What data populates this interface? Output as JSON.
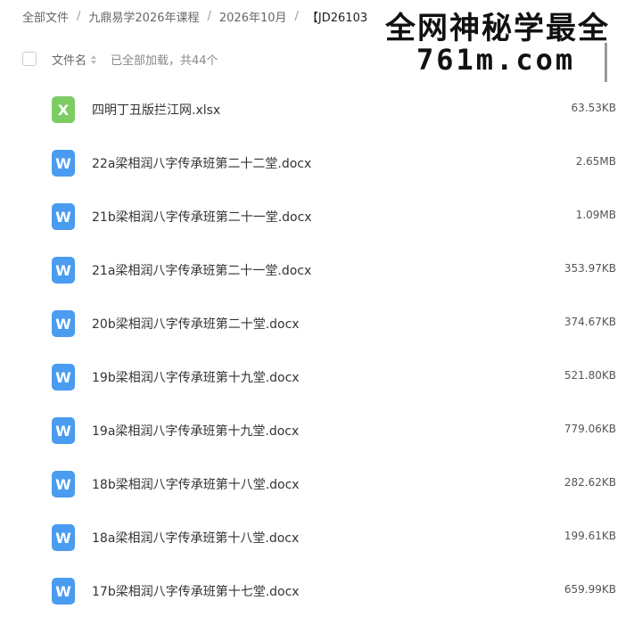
{
  "breadcrumb": {
    "items": [
      "全部文件",
      "九鼎易学2026年课程",
      "2026年10月"
    ],
    "current": "【JD26103",
    "separator": "/"
  },
  "list_header": {
    "column_label": "文件名",
    "count_text": "已全部加载，共44个"
  },
  "watermark": {
    "line1": "全网神秘学最全",
    "line2": "761m.com"
  },
  "files": [
    {
      "name": "四明丁丑版拦江网.xlsx",
      "size": "63.53KB",
      "icon": "excel-icon",
      "glyph": "X"
    },
    {
      "name": "22a梁相润八字传承班第二十二堂.docx",
      "size": "2.65MB",
      "icon": "word-icon",
      "glyph": "W"
    },
    {
      "name": "21b梁相润八字传承班第二十一堂.docx",
      "size": "1.09MB",
      "icon": "word-icon",
      "glyph": "W"
    },
    {
      "name": "21a梁相润八字传承班第二十一堂.docx",
      "size": "353.97KB",
      "icon": "word-icon",
      "glyph": "W"
    },
    {
      "name": "20b梁相润八字传承班第二十堂.docx",
      "size": "374.67KB",
      "icon": "word-icon",
      "glyph": "W"
    },
    {
      "name": "19b梁相润八字传承班第十九堂.docx",
      "size": "521.80KB",
      "icon": "word-icon",
      "glyph": "W"
    },
    {
      "name": "19a梁相润八字传承班第十九堂.docx",
      "size": "779.06KB",
      "icon": "word-icon",
      "glyph": "W"
    },
    {
      "name": "18b梁相润八字传承班第十八堂.docx",
      "size": "282.62KB",
      "icon": "word-icon",
      "glyph": "W"
    },
    {
      "name": "18a梁相润八字传承班第十八堂.docx",
      "size": "199.61KB",
      "icon": "word-icon",
      "glyph": "W"
    },
    {
      "name": "17b梁相润八字传承班第十七堂.docx",
      "size": "659.99KB",
      "icon": "word-icon",
      "glyph": "W"
    }
  ],
  "colors": {
    "excel_icon": "#7ccc63",
    "word_icon": "#4a9cf0"
  }
}
